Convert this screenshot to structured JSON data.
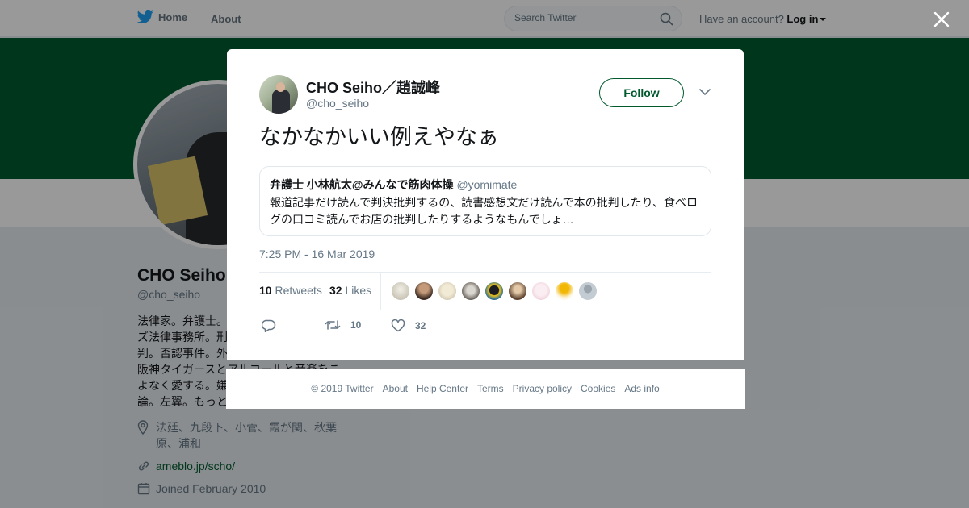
{
  "topbar": {
    "home_label": "Home",
    "about_label": "About",
    "search_placeholder": "Search Twitter",
    "account_prompt": "Have an account?",
    "login_label": "Log in"
  },
  "profile": {
    "name": "CHO Seiho",
    "handle": "@cho_seiho",
    "bio_lines": [
      "法律家。弁護士。",
      "ズ法律事務所。刑",
      "判。否認事件。外",
      "阪神タイガースとアルコールと音楽をこ",
      "よなく愛する。嫌",
      "論。左翼。もっと"
    ],
    "location_lines": [
      "法廷、九段下、小菅、霞が関、秋葉",
      "原、浦和"
    ],
    "website": "ameblo.jp/scho/",
    "joined": "Joined February 2010"
  },
  "tweet": {
    "author_name": "CHO Seiho／趙誠峰",
    "author_handle": "@cho_seiho",
    "follow_label": "Follow",
    "text": "なかなかいい例えやなぁ",
    "quoted": {
      "name": "弁護士 小林航太@みんなで筋肉体操",
      "handle": "@yomimate",
      "line1": "報道記事だけ読んで判決批判するの、読書感想文だけ読んで本の批判したり、食べロ",
      "line2": "グの口コミ読んでお店の批判したりするようなもんでしょ…"
    },
    "timestamp": "7:25 PM - 16 Mar 2019",
    "retweets_count": "10",
    "retweets_label": "Retweets",
    "likes_count": "32",
    "likes_label": "Likes",
    "action_retweet_count": "10",
    "action_like_count": "32"
  },
  "footer": {
    "copyright": "© 2019 Twitter",
    "links": [
      "About",
      "Help Center",
      "Terms",
      "Privacy policy",
      "Cookies",
      "Ads info"
    ]
  },
  "colors": {
    "brand": "#005a2e",
    "twitter_blue": "#1da1f2",
    "muted": "#657786"
  },
  "icons": [
    "twitter-bird-icon",
    "search-icon",
    "close-icon",
    "chevron-down-icon",
    "location-icon",
    "link-icon",
    "calendar-icon",
    "reply-icon",
    "retweet-icon",
    "heart-icon"
  ]
}
